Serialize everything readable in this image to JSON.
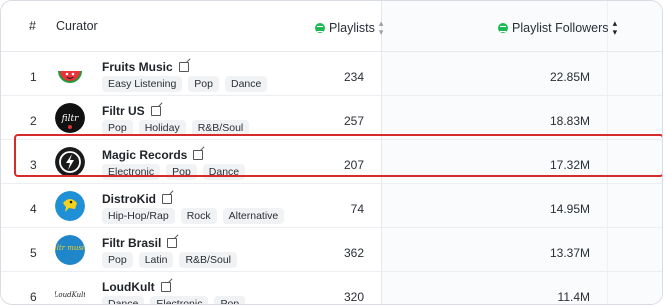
{
  "header": {
    "rank": "#",
    "curator": "Curator",
    "playlists": "Playlists",
    "followers": "Playlist Followers"
  },
  "rows": [
    {
      "rank": "1",
      "name": "Fruits Music",
      "tags": [
        "Easy Listening",
        "Pop",
        "Dance"
      ],
      "playlists": "234",
      "followers": "22.85M"
    },
    {
      "rank": "2",
      "name": "Filtr US",
      "tags": [
        "Pop",
        "Holiday",
        "R&B/Soul"
      ],
      "playlists": "257",
      "followers": "18.83M"
    },
    {
      "rank": "3",
      "name": "Magic Records",
      "tags": [
        "Electronic",
        "Pop",
        "Dance"
      ],
      "playlists": "207",
      "followers": "17.32M"
    },
    {
      "rank": "4",
      "name": "DistroKid",
      "tags": [
        "Hip-Hop/Rap",
        "Rock",
        "Alternative"
      ],
      "playlists": "74",
      "followers": "14.95M"
    },
    {
      "rank": "5",
      "name": "Filtr Brasil",
      "tags": [
        "Pop",
        "Latin",
        "R&B/Soul"
      ],
      "playlists": "362",
      "followers": "13.37M"
    },
    {
      "rank": "6",
      "name": "LoudKult",
      "tags": [
        "Dance",
        "Electronic",
        "Pop"
      ],
      "playlists": "320",
      "followers": "11.4M"
    }
  ],
  "logos": {
    "filtr_us_text": "filtr",
    "filtr_brasil_text": "filtr music",
    "loudkult_text": "LoudKult"
  },
  "colors": {
    "spotify_green": "#1db954",
    "highlight": "#d72a2a"
  },
  "icons": {
    "spotify": "spotify-icon",
    "external_link": "external-link-icon",
    "sort": "sort-arrows-icon"
  }
}
